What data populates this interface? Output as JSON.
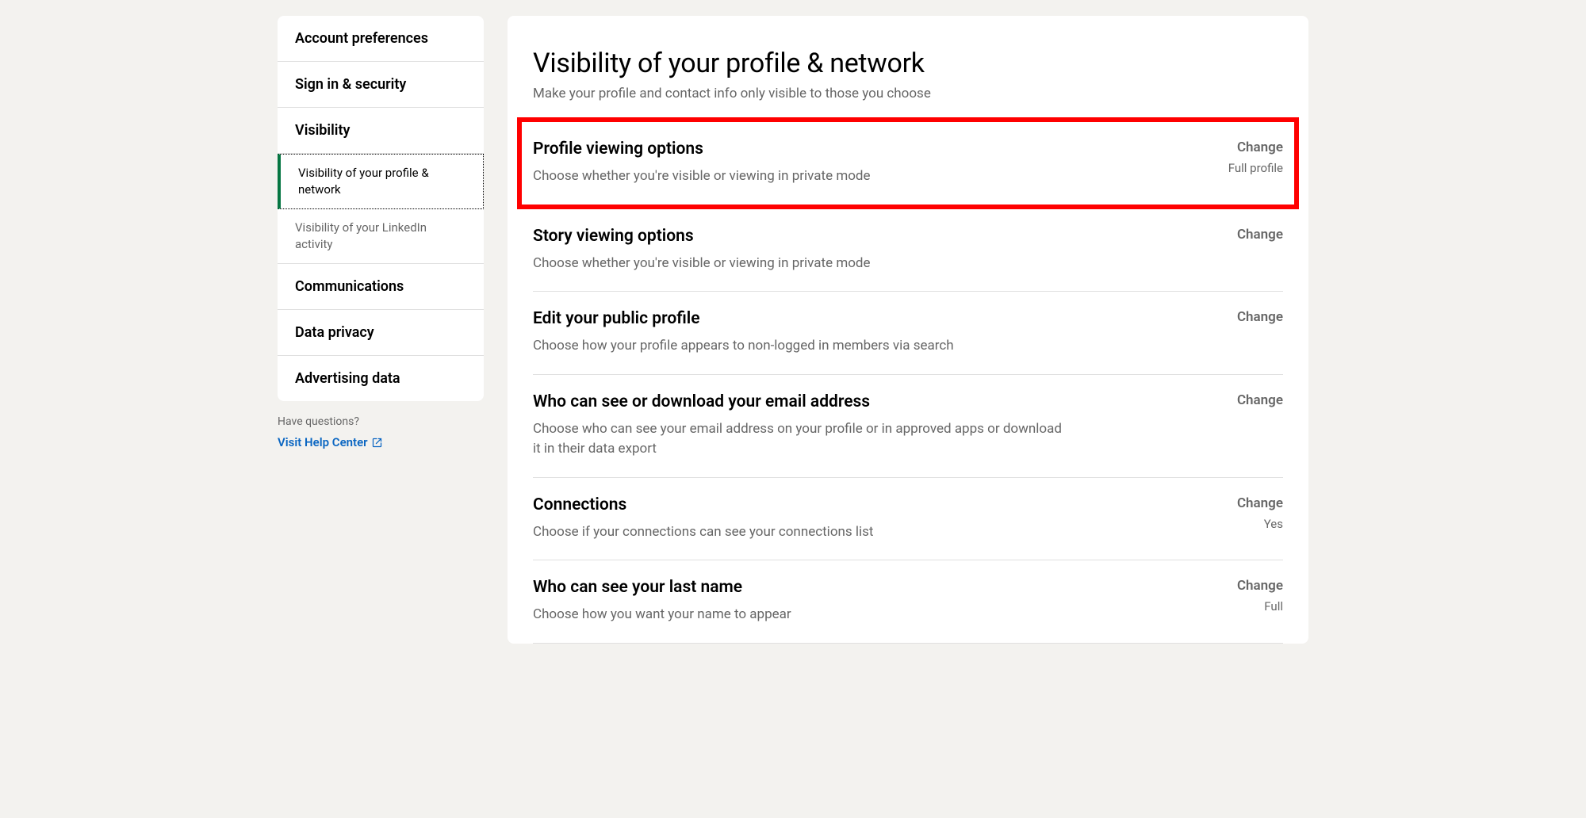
{
  "sidebar": {
    "items": [
      {
        "label": "Account preferences",
        "type": "main"
      },
      {
        "label": "Sign in & security",
        "type": "main"
      },
      {
        "label": "Visibility",
        "type": "main"
      },
      {
        "label": "Visibility of your profile & network",
        "type": "sub",
        "selected": true
      },
      {
        "label": "Visibility of your LinkedIn activity",
        "type": "sub",
        "selected": false
      },
      {
        "label": "Communications",
        "type": "main"
      },
      {
        "label": "Data privacy",
        "type": "main"
      },
      {
        "label": "Advertising data",
        "type": "main"
      }
    ],
    "help_question": "Have questions?",
    "help_link": "Visit Help Center"
  },
  "main": {
    "title": "Visibility of your profile & network",
    "subtitle": "Make your profile and contact info only visible to those you choose",
    "settings": [
      {
        "title": "Profile viewing options",
        "desc": "Choose whether you're visible or viewing in private mode",
        "action": "Change",
        "status": "Full profile",
        "highlighted": true
      },
      {
        "title": "Story viewing options",
        "desc": "Choose whether you're visible or viewing in private mode",
        "action": "Change",
        "status": ""
      },
      {
        "title": "Edit your public profile",
        "desc": "Choose how your profile appears to non-logged in members via search",
        "action": "Change",
        "status": ""
      },
      {
        "title": "Who can see or download your email address",
        "desc": "Choose who can see your email address on your profile or in approved apps or download it in their data export",
        "action": "Change",
        "status": ""
      },
      {
        "title": "Connections",
        "desc": "Choose if your connections can see your connections list",
        "action": "Change",
        "status": "Yes"
      },
      {
        "title": "Who can see your last name",
        "desc": "Choose how you want your name to appear",
        "action": "Change",
        "status": "Full"
      }
    ]
  }
}
